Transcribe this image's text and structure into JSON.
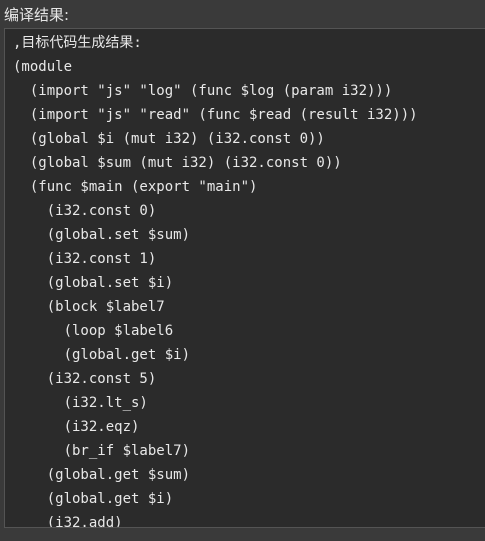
{
  "panel": {
    "title": "编译结果:"
  },
  "output": {
    "lines": [
      ",目标代码生成结果:",
      "(module",
      "  (import \"js\" \"log\" (func $log (param i32)))",
      "  (import \"js\" \"read\" (func $read (result i32)))",
      "  (global $i (mut i32) (i32.const 0))",
      "  (global $sum (mut i32) (i32.const 0))",
      "  (func $main (export \"main\")",
      "    (i32.const 0)",
      "    (global.set $sum)",
      "    (i32.const 1)",
      "    (global.set $i)",
      "    (block $label7",
      "      (loop $label6",
      "      (global.get $i)",
      "    (i32.const 5)",
      "      (i32.lt_s)",
      "      (i32.eqz)",
      "      (br_if $label7)",
      "    (global.get $sum)",
      "    (global.get $i)",
      "    (i32.add)"
    ]
  }
}
